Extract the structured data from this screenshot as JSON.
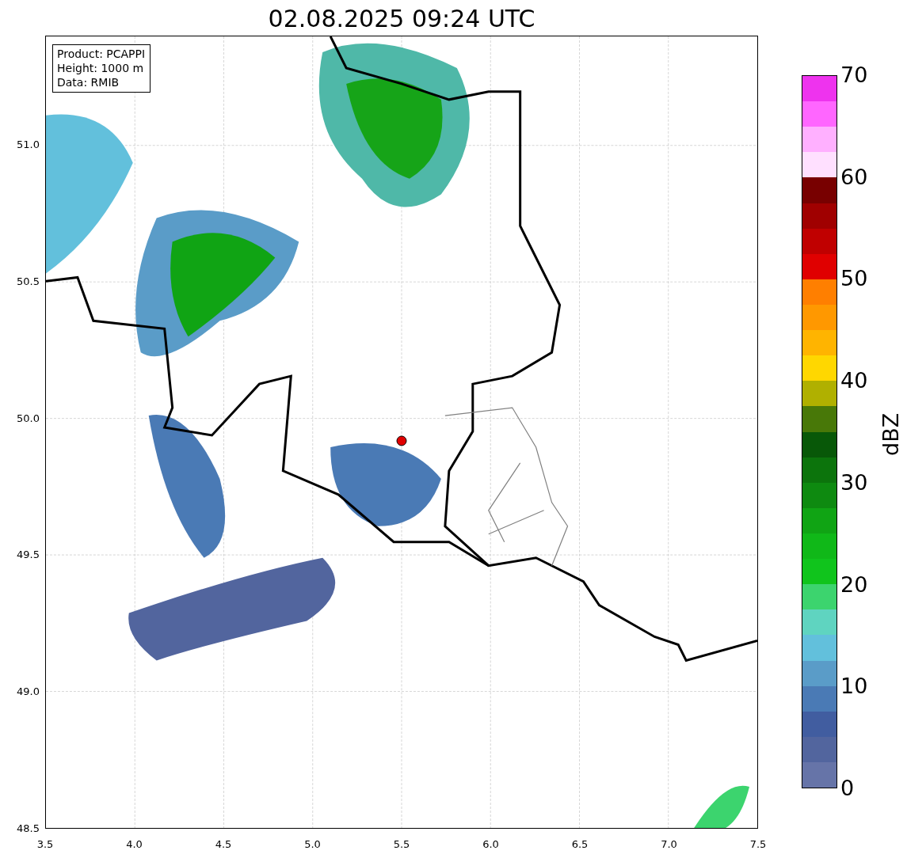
{
  "title": "02.08.2025 09:24 UTC",
  "info_box": [
    "Product: PCAPPI",
    "Height: 1000 m",
    "Data: RMIB"
  ],
  "map": {
    "y_ticks": [
      "51.0",
      "50.5",
      "50.0",
      "49.5",
      "49.0",
      "48.5"
    ],
    "x_ticks": [
      "3.5",
      "4.0",
      "4.5",
      "5.0",
      "5.5",
      "6.0",
      "6.5",
      "7.0",
      "7.5"
    ]
  },
  "colorbar": {
    "label": "dBZ",
    "ticks": [
      "70",
      "60",
      "50",
      "40",
      "30",
      "20",
      "10",
      "0"
    ],
    "bins": [
      {
        "color": "#ee33ee"
      },
      {
        "color": "#ff66ff"
      },
      {
        "color": "#ffb0ff"
      },
      {
        "color": "#ffe0ff"
      },
      {
        "color": "#780000"
      },
      {
        "color": "#a00000"
      },
      {
        "color": "#c00000"
      },
      {
        "color": "#e00000"
      },
      {
        "color": "#ff7f00"
      },
      {
        "color": "#ff9800"
      },
      {
        "color": "#ffb400"
      },
      {
        "color": "#ffd700"
      },
      {
        "color": "#b0b000"
      },
      {
        "color": "#487808"
      },
      {
        "color": "#085808"
      },
      {
        "color": "#0c740c"
      },
      {
        "color": "#0e8a10"
      },
      {
        "color": "#10a414"
      },
      {
        "color": "#10b818"
      },
      {
        "color": "#10c41c"
      },
      {
        "color": "#3cd46e"
      },
      {
        "color": "#5fd4c0"
      },
      {
        "color": "#62c0dc"
      },
      {
        "color": "#5a9cc8"
      },
      {
        "color": "#4a7ab5"
      },
      {
        "color": "#415da0"
      },
      {
        "color": "#52659e"
      },
      {
        "color": "#6674a8"
      }
    ]
  }
}
